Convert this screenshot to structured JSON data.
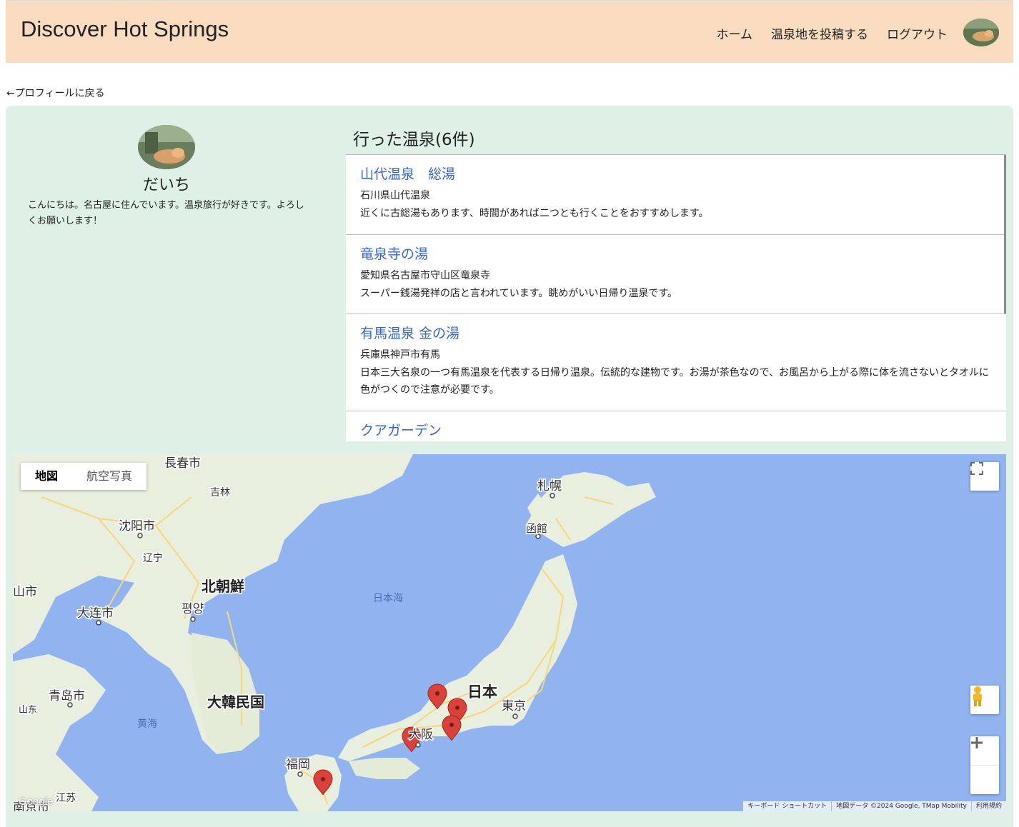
{
  "navbar": {
    "brand": "Discover Hot Springs",
    "links": [
      "ホーム",
      "温泉地を投稿する",
      "ログアウト"
    ]
  },
  "back_link": "プロフィールに戻る",
  "profile": {
    "name": "だいち",
    "bio": "こんにちは。名古屋に住んでいます。温泉旅行が好きです。よろしくお願いします！"
  },
  "springs_list": {
    "title": "行った温泉(6件)",
    "items": [
      {
        "name": "山代温泉　総湯",
        "location": "石川県山代温泉",
        "description": "近くに古総湯もあります、時間があれば二つとも行くことをおすすめします。"
      },
      {
        "name": "竜泉寺の湯",
        "location": "愛知県名古屋市守山区竜泉寺",
        "description": "スーパー銭湯発祥の店と言われています。眺めがいい日帰り温泉です。"
      },
      {
        "name": "有馬温泉 金の湯",
        "location": "兵庫県神戸市有馬",
        "description": "日本三大名泉の一つ有馬温泉を代表する日帰り温泉。伝統的な建物です。お湯が茶色なので、お風呂から上がる際に体を流さないとタオルに色がつくので注意が必要です。"
      },
      {
        "name": "クアガーデン",
        "location": "",
        "description": ""
      }
    ]
  },
  "map": {
    "type_buttons": [
      "地図",
      "航空写真"
    ],
    "labels": [
      "長春市",
      "吉林",
      "沈阳市",
      "辽宁",
      "北朝鮮",
      "평양",
      "大连市",
      "山市",
      "札幌",
      "函館",
      "日本海",
      "日本",
      "東京",
      "大阪",
      "大韓民国",
      "青岛市",
      "山东",
      "黄海",
      "福岡",
      "江苏",
      "南京市"
    ],
    "attribution": [
      "キーボード ショートカット",
      "地図データ ©2024 Google, TMap Mobility",
      "利用規約"
    ],
    "logo": "Google",
    "colors": {
      "water": "#91b4f0",
      "land": "#e9efdf",
      "road": "#f7d77a",
      "marker": "#d9413a"
    }
  }
}
